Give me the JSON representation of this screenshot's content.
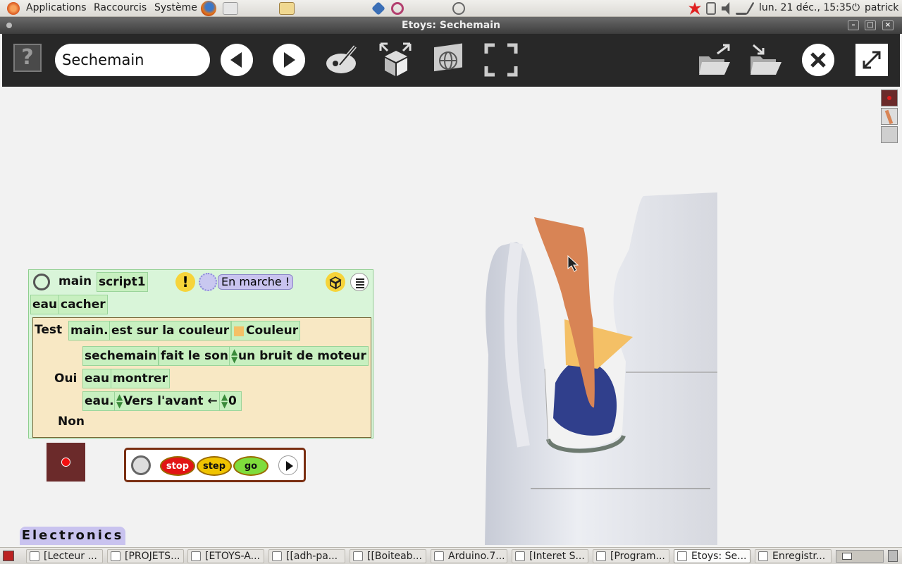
{
  "top_panel": {
    "applications": "Applications",
    "places": "Raccourcis",
    "system": "Système",
    "clock": "lun. 21 déc., 15:35",
    "user": "patrick"
  },
  "window": {
    "title": "Etoys: Sechemain",
    "minimize": "–",
    "maximize": "□",
    "close": "×"
  },
  "toolbar": {
    "help": "?",
    "project_name": "Sechemain"
  },
  "script": {
    "player": "main",
    "name": "script1",
    "exclamation": "!",
    "status": "En marche !",
    "first_line_subject": "eau",
    "first_line_command": "cacher",
    "test_label": "Test",
    "test_subject": "main.",
    "test_predicate": "est sur la couleur",
    "test_color_label": "Couleur",
    "yes_label": "Oui",
    "no_label": "Non",
    "yes_lines": [
      {
        "subject": "sechemain",
        "command": "fait le son",
        "arg": "un bruit de moteur"
      },
      {
        "subject": "eau",
        "command": "montrer"
      },
      {
        "subject": "eau.",
        "command": "Vers l'avant",
        "arrow": "←",
        "value": "0"
      }
    ]
  },
  "controls": {
    "stop": "stop",
    "step": "step",
    "go": "go"
  },
  "flap": {
    "label": "Electronics"
  },
  "taskbar": [
    {
      "label": "[Lecteur ...",
      "active": false
    },
    {
      "label": "[PROJETS...",
      "active": false
    },
    {
      "label": "[ETOYS-A...",
      "active": false
    },
    {
      "label": "[[adh-pa...",
      "active": false
    },
    {
      "label": "[[Boiteab...",
      "active": false
    },
    {
      "label": "Arduino.7...",
      "active": false
    },
    {
      "label": "[Interet S...",
      "active": false
    },
    {
      "label": "[Program...",
      "active": false
    },
    {
      "label": "Etoys: Se...",
      "active": true
    },
    {
      "label": "Enregistr...",
      "active": false
    }
  ],
  "colors": {
    "script_bg": "#d9f5d9",
    "test_bg": "#f8e8c4",
    "tile_bg": "#c8f0c0",
    "toolbar_bg": "#282828",
    "flap_bg": "#c9c3ef",
    "stop": "#e21414",
    "step": "#f0c400",
    "go": "#7fdc3c"
  }
}
